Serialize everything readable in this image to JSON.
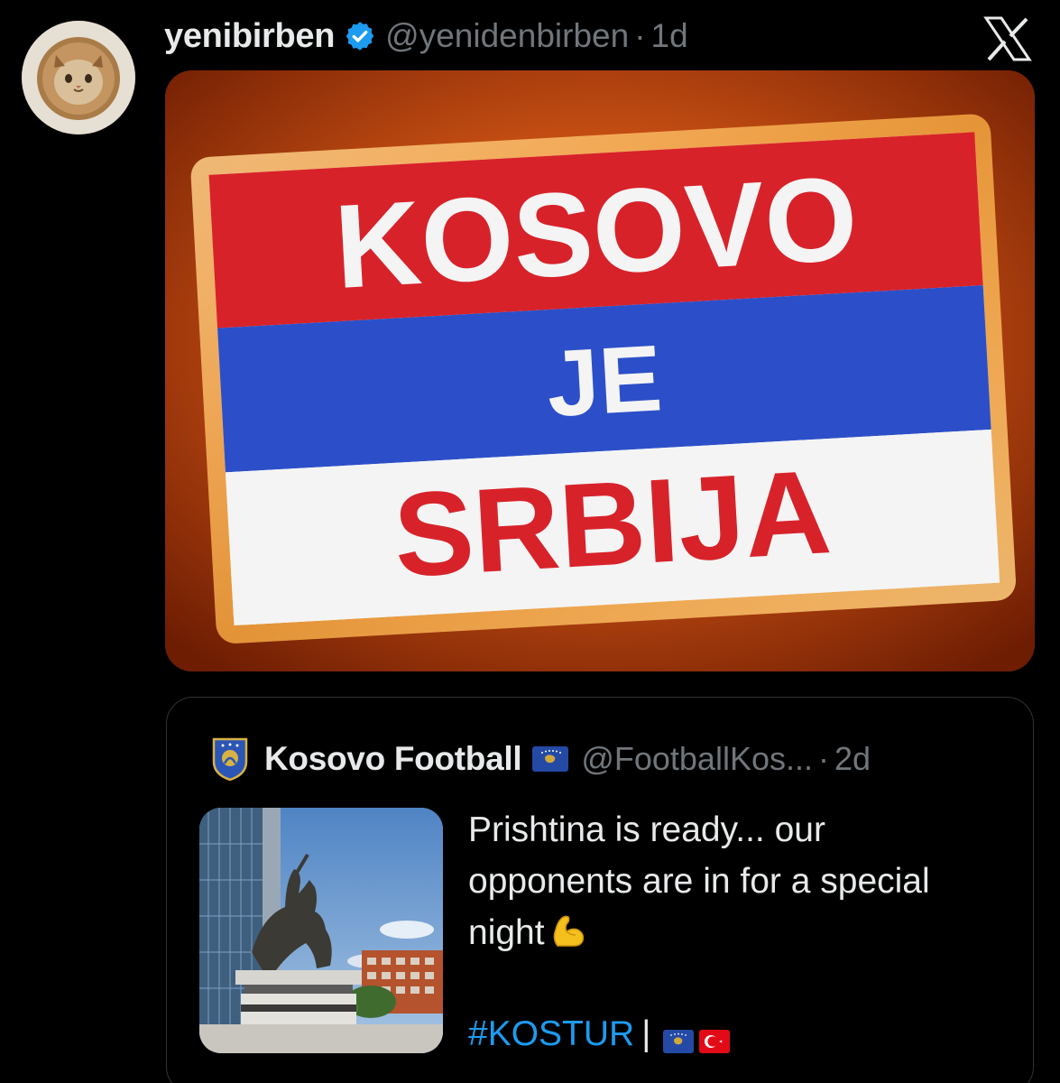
{
  "tweet": {
    "display_name": "yenibirben",
    "handle": "@yenidenbirben",
    "separator": "·",
    "time": "1d",
    "avatar_icon": "cat-lion-mane-avatar",
    "verified_icon": "verified-badge-icon",
    "brand_icon": "x-logo-icon"
  },
  "media": {
    "line1": "KOSOVO",
    "line2": "JE",
    "line3": "SRBIJA",
    "colors": {
      "red": "#d8222a",
      "blue": "#2c4fc9",
      "white": "#f4f4f4",
      "background": "#b8420f"
    }
  },
  "quote": {
    "display_name": "Kosovo Football",
    "handle": "@FootballKos...",
    "separator": "·",
    "time": "2d",
    "crest_icon": "kosovo-football-crest-icon",
    "flag_icon": "kosovo-flag-icon",
    "text_line1": "Prishtina is ready... our",
    "text_line2": "opponents are in for a special",
    "text_line3": "night",
    "emoji": "flexed-biceps-icon",
    "hashtag": "#KOSTUR",
    "hashtag_separator": "|",
    "flags": [
      "kosovo-flag-icon",
      "turkey-flag-icon"
    ]
  },
  "colors": {
    "background": "#000000",
    "text": "#e7e9ea",
    "muted": "#71767b",
    "link": "#1d9bf0",
    "verified": "#1d9bf0",
    "border": "#2f3336"
  }
}
